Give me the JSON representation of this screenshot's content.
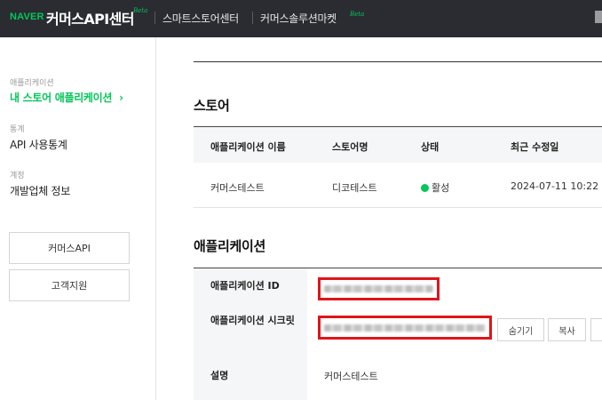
{
  "header": {
    "brand": "NAVER",
    "title": "커머스API센터",
    "title_badge": "Beta",
    "nav": [
      {
        "label": "스마트스토어센터"
      },
      {
        "label": "커머스솔루션마켓",
        "badge": "Beta"
      }
    ]
  },
  "sidebar": {
    "groups": [
      {
        "label": "애플리케이션",
        "item": "내 스토어 애플리케이션",
        "active": true,
        "arrow": "›"
      },
      {
        "label": "통계",
        "item": "API 사용통계"
      },
      {
        "label": "계정",
        "item": "개발업체 정보"
      }
    ],
    "buttons": [
      "커머스API",
      "고객지원"
    ]
  },
  "store_section": {
    "title": "스토어",
    "columns": [
      "애플리케이션 이름",
      "스토어명",
      "상태",
      "최근 수정일"
    ],
    "rows": [
      {
        "app_name": "커머스테스트",
        "store_name": "디코테스트",
        "status": "활성",
        "modified": "2024-07-11 10:22"
      }
    ]
  },
  "app_section": {
    "title": "애플리케이션",
    "fields": {
      "app_id_label": "애플리케이션 ID",
      "secret_label": "애플리케이션 시크릿",
      "description_label": "설명",
      "description_value": "커머스테스트"
    },
    "secret_buttons": [
      "숨기기",
      "복사",
      ""
    ]
  },
  "colors": {
    "accent": "#03c75a",
    "topbar": "#2a2c31",
    "redaction_border": "#e0141b"
  }
}
